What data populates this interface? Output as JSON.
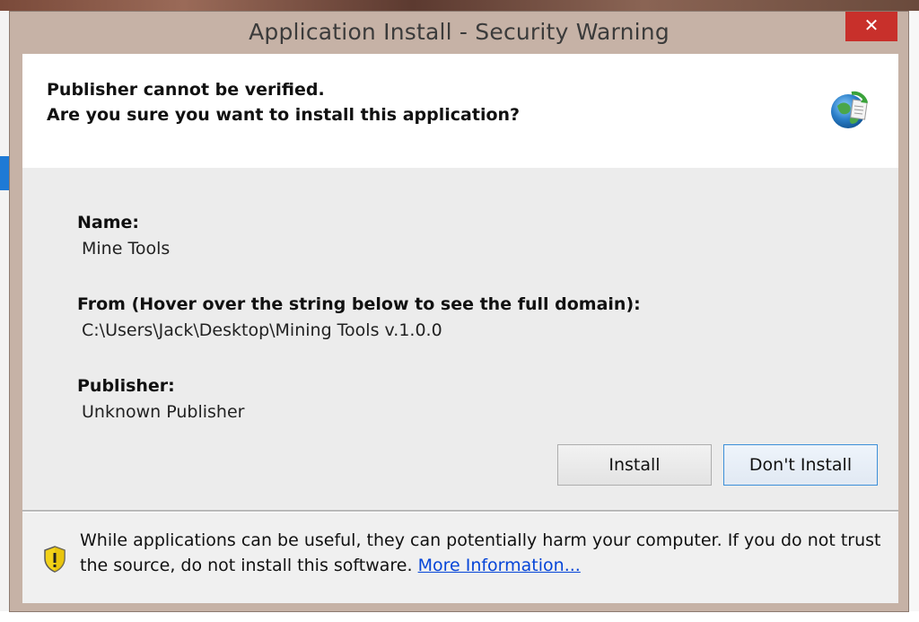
{
  "window": {
    "title": "Application Install - Security Warning",
    "close_glyph": "✕"
  },
  "header": {
    "line1": "Publisher cannot be verified.",
    "line2": "Are you sure you want to install this application?",
    "icon": "clickonce-globe-icon"
  },
  "details": {
    "name_label": "Name:",
    "name_value": "Mine Tools",
    "from_label": "From (Hover over the string below to see the full domain):",
    "from_value": "C:\\Users\\Jack\\Desktop\\Mining Tools v.1.0.0",
    "publisher_label": "Publisher:",
    "publisher_value": "Unknown Publisher"
  },
  "buttons": {
    "install": "Install",
    "dont_install": "Don't Install"
  },
  "footer": {
    "warning_text": "While applications can be useful, they can potentially harm your computer. If you do not trust the source, do not install this software. ",
    "more_info_link": "More Information...",
    "icon": "shield-warning-icon"
  },
  "colors": {
    "close_button": "#c8302b",
    "frame": "#c6b2a6",
    "link": "#0645d8",
    "default_button_border": "#3c8fd8"
  }
}
